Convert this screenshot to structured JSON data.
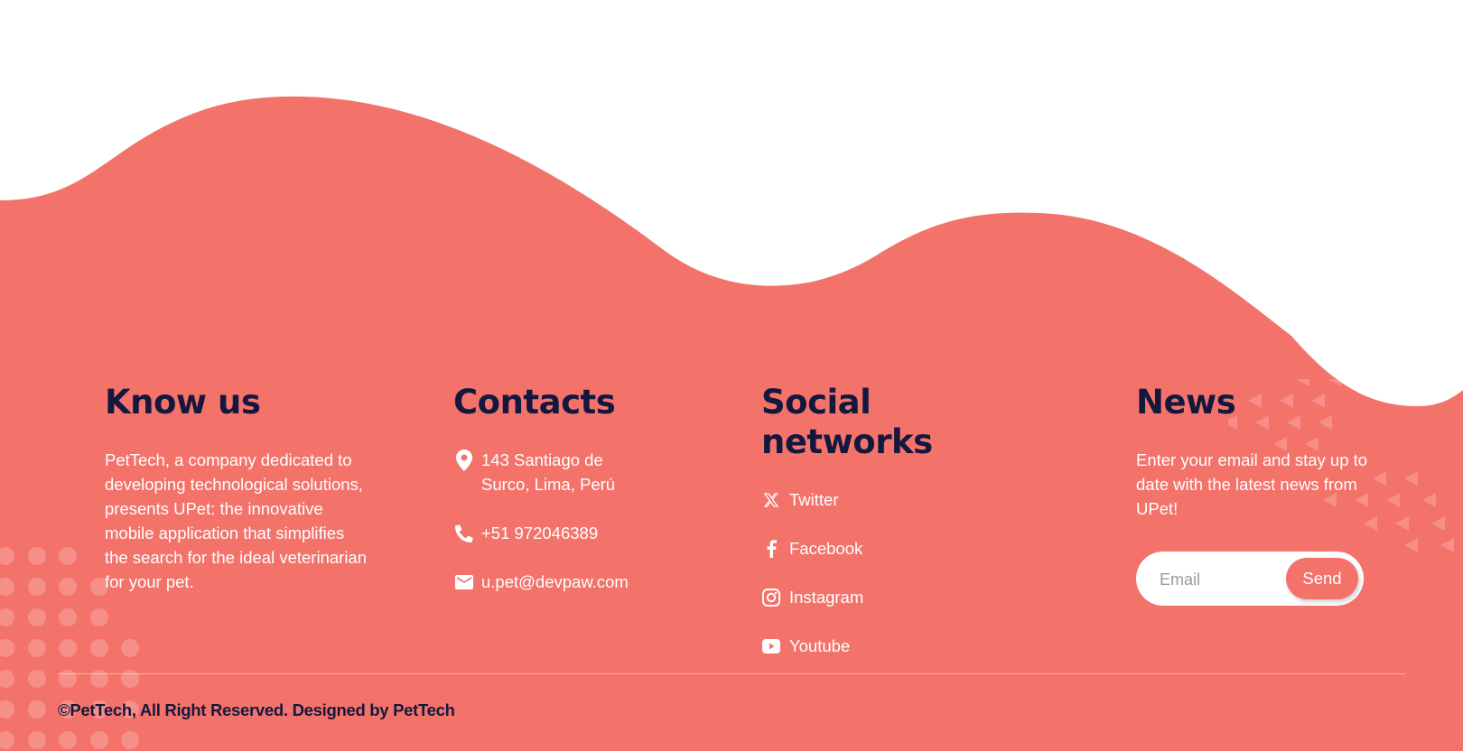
{
  "colors": {
    "coral": "#f3736b",
    "navy": "#14183e",
    "white": "#ffffff"
  },
  "know_us": {
    "title": "Know us",
    "text": "PetTech, a company dedicated to developing technological solutions, presents UPet: the innovative mobile application that simplifies the search for the ideal veterinarian for your pet."
  },
  "contacts": {
    "title": "Contacts",
    "address": "143 Santiago de Surco, Lima, Perú",
    "phone": "+51 972046389",
    "email": "u.pet@devpaw.com",
    "icons": [
      "location-pin-icon",
      "phone-icon",
      "mail-icon"
    ]
  },
  "social": {
    "title": "Social networks",
    "items": [
      {
        "label": "Twitter",
        "icon": "x-twitter-icon"
      },
      {
        "label": "Facebook",
        "icon": "facebook-icon"
      },
      {
        "label": "Instagram",
        "icon": "instagram-icon"
      },
      {
        "label": "Youtube",
        "icon": "youtube-icon"
      }
    ]
  },
  "news": {
    "title": "News",
    "text": "Enter your email and stay up to date with the latest news from UPet!",
    "email_placeholder": "Email",
    "send_label": "Send"
  },
  "footer": {
    "copyright": "©PetTech, All Right Reserved. Designed by PetTech"
  }
}
